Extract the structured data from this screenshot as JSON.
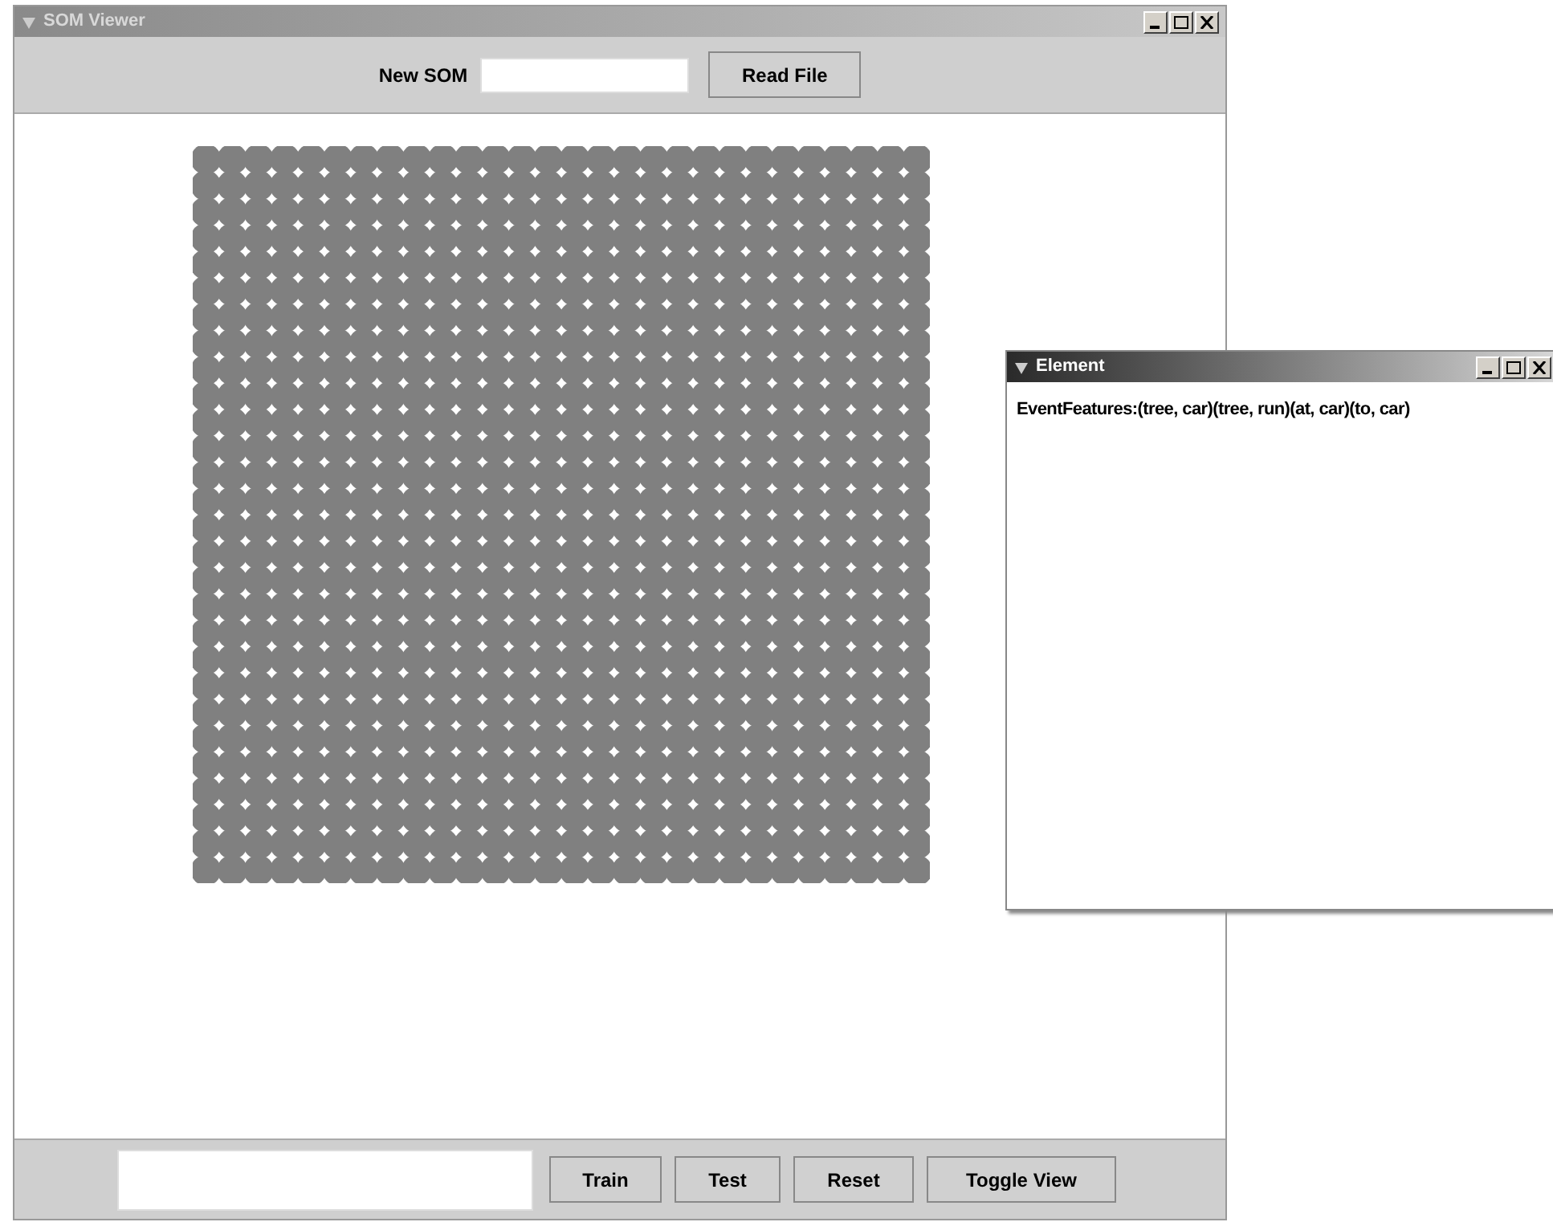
{
  "main_window": {
    "title": "SOM Viewer",
    "active": false
  },
  "top_bar": {
    "label": "New SOM",
    "button": "Read File"
  },
  "bottom_bar": {
    "buttons": [
      "Train",
      "Test",
      "Reset",
      "Toggle View"
    ]
  },
  "element_window": {
    "title": "Element",
    "active": true,
    "text": "EventFeatures:(tree, car)(tree, run)(at, car)(to, car)"
  }
}
